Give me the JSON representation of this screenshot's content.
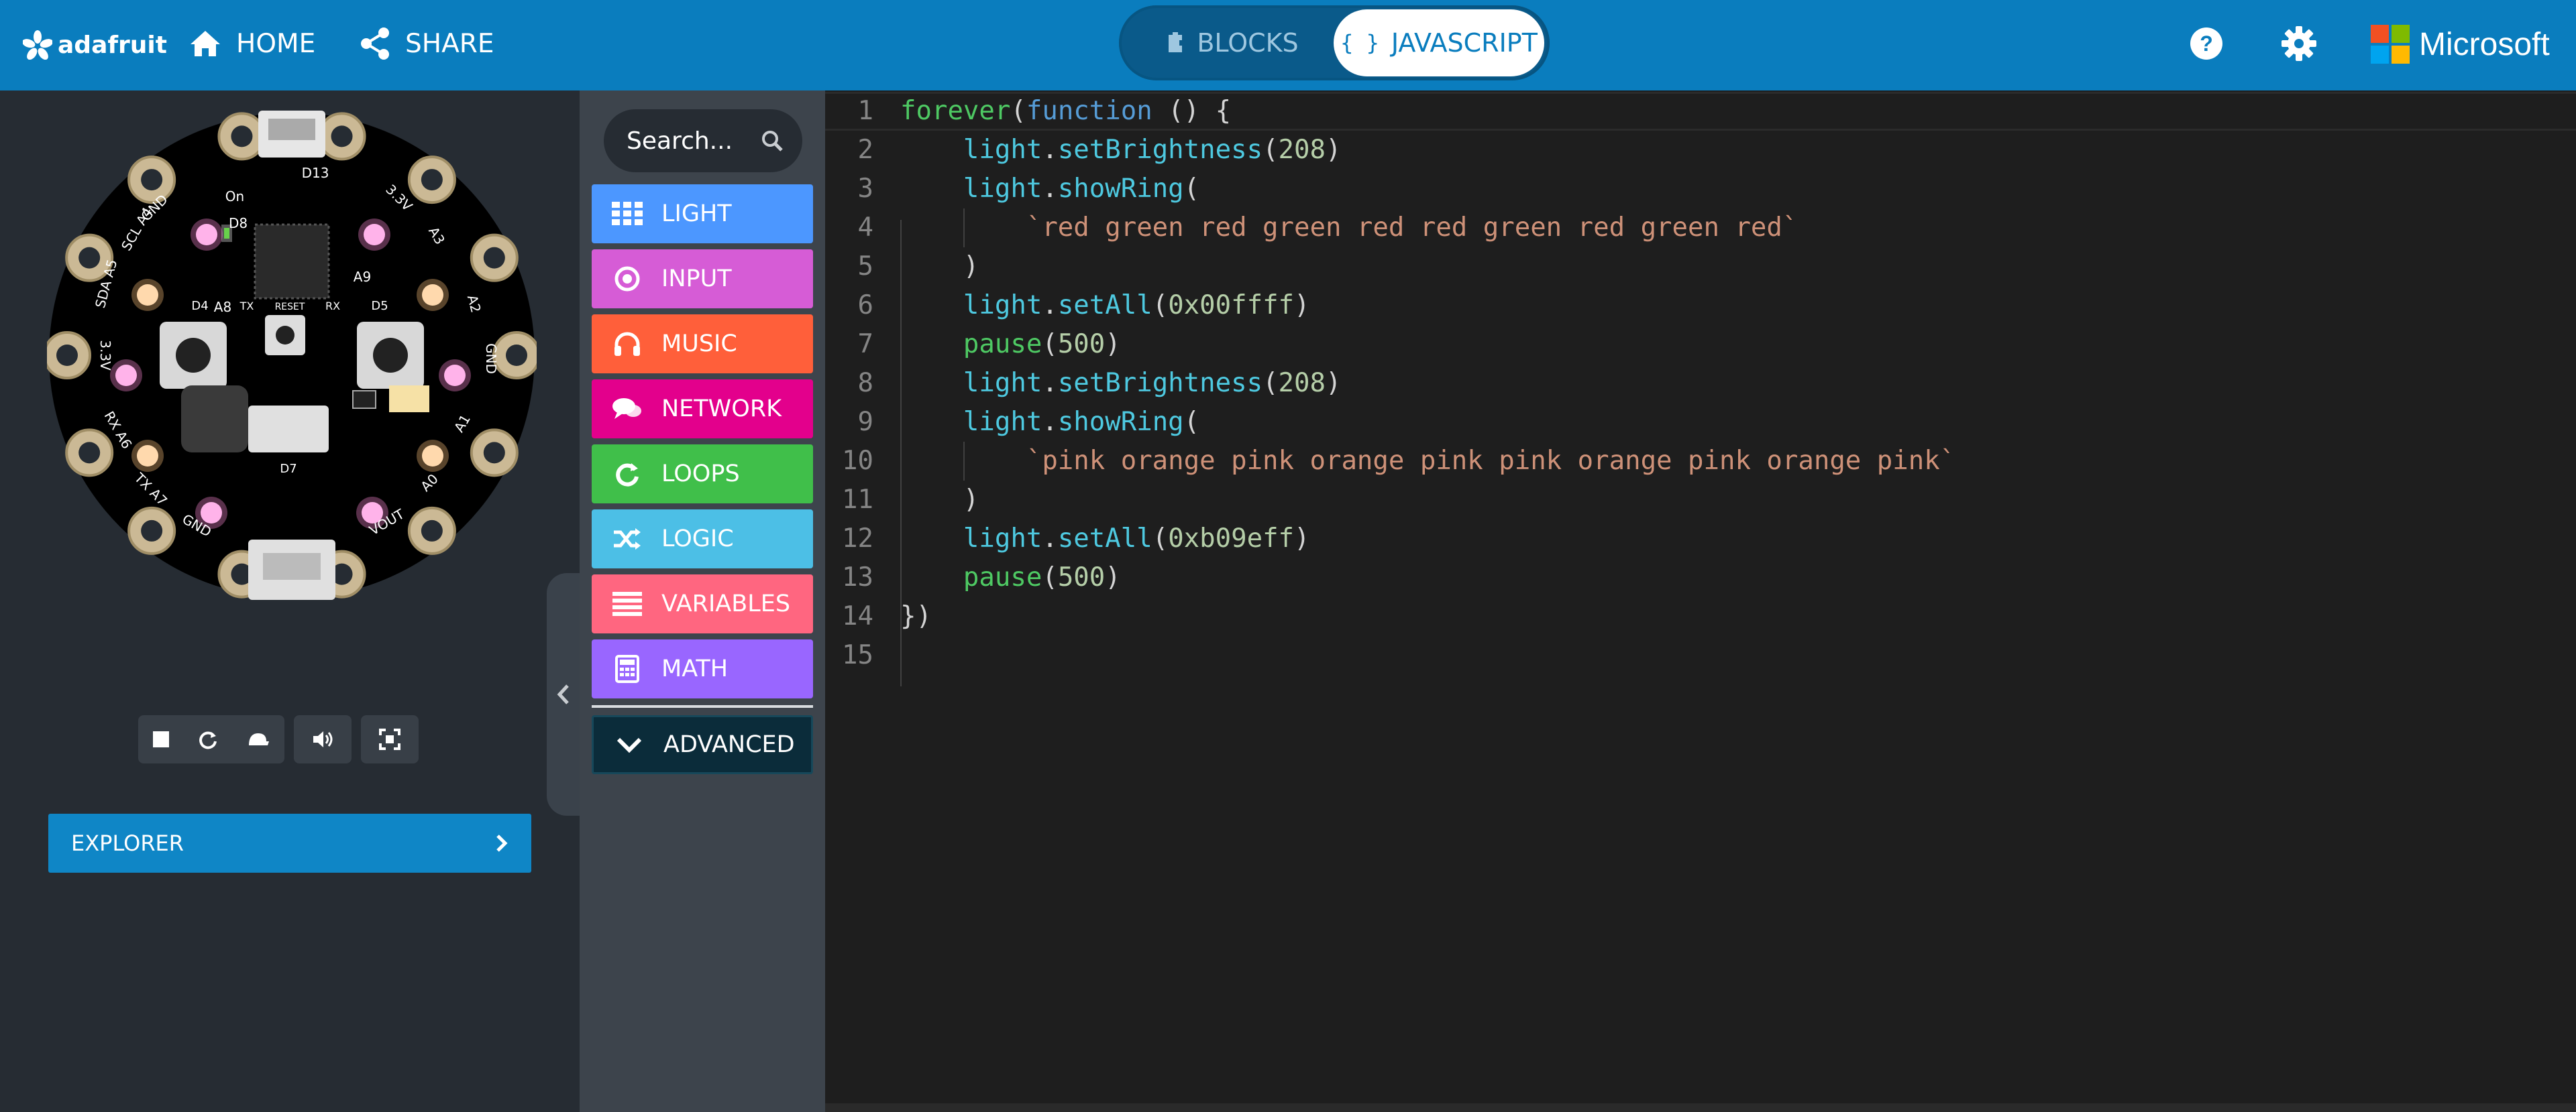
{
  "header": {
    "brand": "adafruit",
    "home_label": "HOME",
    "share_label": "SHARE",
    "blocks_label": "BLOCKS",
    "javascript_label": "JAVASCRIPT",
    "microsoft_label": "Microsoft",
    "accent": "#0a7dbe"
  },
  "simulator": {
    "explorer_label": "EXPLORER",
    "board_pin_labels": [
      "GND",
      "D13",
      "3.3V",
      "A3",
      "A2",
      "GND",
      "A1",
      "A0",
      "VOUT",
      "GND",
      "TX A7",
      "RX A6",
      "3.3V",
      "SDA A5",
      "SCL A4",
      "D8",
      "A8",
      "A9",
      "D4",
      "D5",
      "TX",
      "RESET",
      "RX",
      "D7",
      "On"
    ],
    "controls": [
      "stop-icon",
      "restart-icon",
      "slow-mo-icon",
      "mute-icon",
      "fullscreen-icon"
    ]
  },
  "toolbox": {
    "search_placeholder": "Search...",
    "categories": [
      {
        "label": "LIGHT",
        "color": "#4c97ff",
        "icon": "grid-icon"
      },
      {
        "label": "INPUT",
        "color": "#d65cd6",
        "icon": "target-icon"
      },
      {
        "label": "MUSIC",
        "color": "#ff5f3a",
        "icon": "headphones-icon"
      },
      {
        "label": "NETWORK",
        "color": "#e3008c",
        "icon": "chat-icon"
      },
      {
        "label": "LOOPS",
        "color": "#40bf4a",
        "icon": "refresh-icon"
      },
      {
        "label": "LOGIC",
        "color": "#4cbfe6",
        "icon": "shuffle-icon"
      },
      {
        "label": "VARIABLES",
        "color": "#ff6680",
        "icon": "list-icon"
      },
      {
        "label": "MATH",
        "color": "#9966ff",
        "icon": "calculator-icon"
      }
    ],
    "advanced_label": "ADVANCED"
  },
  "editor": {
    "lines": [
      {
        "n": "1",
        "tokens": [
          [
            "fn",
            "forever"
          ],
          [
            "plain",
            "("
          ],
          [
            "kw",
            "function"
          ],
          [
            "plain",
            " () {"
          ]
        ]
      },
      {
        "n": "2",
        "tokens": [
          [
            "plain",
            "    "
          ],
          [
            "prop",
            "light"
          ],
          [
            "plain",
            "."
          ],
          [
            "prop",
            "setBrightness"
          ],
          [
            "plain",
            "("
          ],
          [
            "num",
            "208"
          ],
          [
            "plain",
            ")"
          ]
        ]
      },
      {
        "n": "3",
        "tokens": [
          [
            "plain",
            "    "
          ],
          [
            "prop",
            "light"
          ],
          [
            "plain",
            "."
          ],
          [
            "prop",
            "showRing"
          ],
          [
            "plain",
            "("
          ]
        ]
      },
      {
        "n": "4",
        "tokens": [
          [
            "plain",
            "        "
          ],
          [
            "str",
            "`red green red green red red green red green red`"
          ]
        ]
      },
      {
        "n": "5",
        "tokens": [
          [
            "plain",
            "    )"
          ]
        ]
      },
      {
        "n": "6",
        "tokens": [
          [
            "plain",
            "    "
          ],
          [
            "prop",
            "light"
          ],
          [
            "plain",
            "."
          ],
          [
            "prop",
            "setAll"
          ],
          [
            "plain",
            "("
          ],
          [
            "num",
            "0x00ffff"
          ],
          [
            "plain",
            ")"
          ]
        ]
      },
      {
        "n": "7",
        "tokens": [
          [
            "plain",
            "    "
          ],
          [
            "fn",
            "pause"
          ],
          [
            "plain",
            "("
          ],
          [
            "num",
            "500"
          ],
          [
            "plain",
            ")"
          ]
        ]
      },
      {
        "n": "8",
        "tokens": [
          [
            "plain",
            "    "
          ],
          [
            "prop",
            "light"
          ],
          [
            "plain",
            "."
          ],
          [
            "prop",
            "setBrightness"
          ],
          [
            "plain",
            "("
          ],
          [
            "num",
            "208"
          ],
          [
            "plain",
            ")"
          ]
        ]
      },
      {
        "n": "9",
        "tokens": [
          [
            "plain",
            "    "
          ],
          [
            "prop",
            "light"
          ],
          [
            "plain",
            "."
          ],
          [
            "prop",
            "showRing"
          ],
          [
            "plain",
            "("
          ]
        ]
      },
      {
        "n": "10",
        "tokens": [
          [
            "plain",
            "        "
          ],
          [
            "str",
            "`pink orange pink orange pink pink orange pink orange pink`"
          ]
        ]
      },
      {
        "n": "11",
        "tokens": [
          [
            "plain",
            "    )"
          ]
        ]
      },
      {
        "n": "12",
        "tokens": [
          [
            "plain",
            "    "
          ],
          [
            "prop",
            "light"
          ],
          [
            "plain",
            "."
          ],
          [
            "prop",
            "setAll"
          ],
          [
            "plain",
            "("
          ],
          [
            "num",
            "0xb09eff"
          ],
          [
            "plain",
            ")"
          ]
        ]
      },
      {
        "n": "13",
        "tokens": [
          [
            "plain",
            "    "
          ],
          [
            "fn",
            "pause"
          ],
          [
            "plain",
            "("
          ],
          [
            "num",
            "500"
          ],
          [
            "plain",
            ")"
          ]
        ]
      },
      {
        "n": "14",
        "tokens": [
          [
            "plain",
            "})"
          ]
        ]
      },
      {
        "n": "15",
        "tokens": []
      }
    ]
  }
}
